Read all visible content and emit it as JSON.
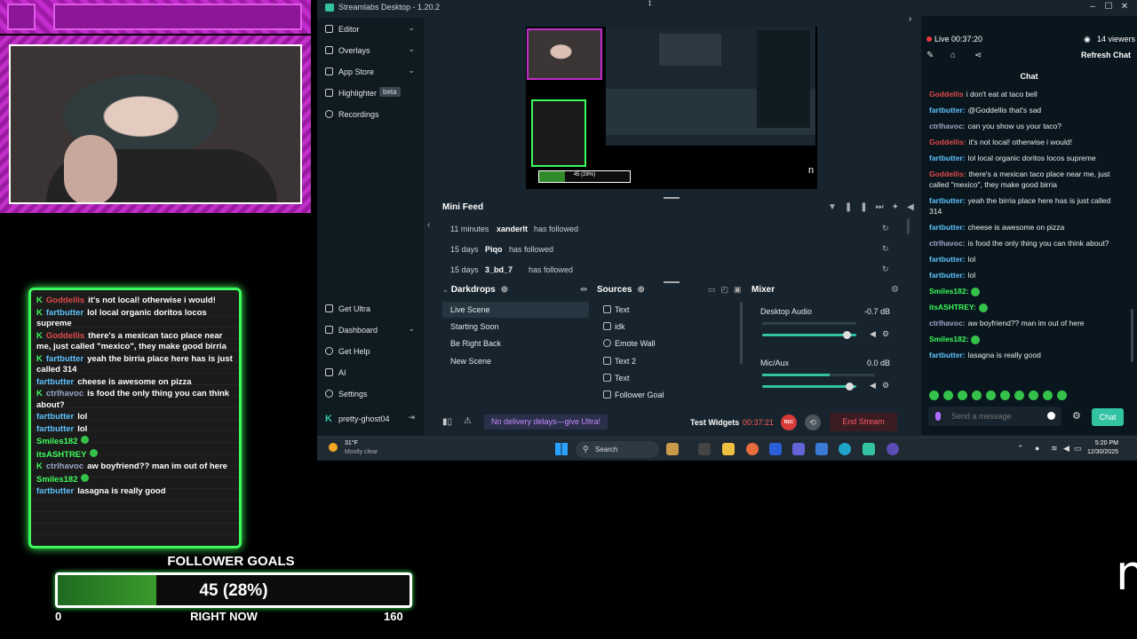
{
  "overlay": {
    "chat": [
      {
        "name": "Goddellis",
        "color": "red",
        "text": "it's not local! otherwise i would!",
        "k": true
      },
      {
        "name": "fartbutter",
        "color": "blue",
        "text": "lol local organic doritos locos supreme",
        "k": true
      },
      {
        "name": "Goddellis",
        "color": "red",
        "text": "there's a mexican taco place near me, just called \"mexico\", they make good birria",
        "k": true
      },
      {
        "name": "fartbutter",
        "color": "blue",
        "text": "yeah the birria place here has is just called 314",
        "k": true
      },
      {
        "name": "fartbutter",
        "color": "blue",
        "text": "cheese is awesome on pizza",
        "k": false
      },
      {
        "name": "ctrlhavoc",
        "color": "grey",
        "text": "is food the only thing you can think about?",
        "k": true
      },
      {
        "name": "fartbutter",
        "color": "blue",
        "text": "lol",
        "k": false
      },
      {
        "name": "fartbutter",
        "color": "blue",
        "text": "lol",
        "k": false
      },
      {
        "name": "Smiles182",
        "color": "green",
        "text": "",
        "k": false
      },
      {
        "name": "itsASHTREY",
        "color": "green",
        "text": "",
        "k": false
      },
      {
        "name": "ctrlhavoc",
        "color": "grey",
        "text": "aw boyfriend?? man im out of here",
        "k": true
      },
      {
        "name": "Smiles182",
        "color": "green",
        "text": "",
        "k": false
      },
      {
        "name": "fartbutter",
        "color": "blue",
        "text": "lasagna is really good",
        "k": false
      }
    ],
    "follower_goal": {
      "title": "FOLLOWER GOALS",
      "value_label": "45 (28%)",
      "progress_fraction": 0.28,
      "min": "0",
      "max": "160",
      "subtitle": "RIGHT NOW"
    },
    "corner_glyph": "n"
  },
  "app": {
    "title": "Streamlabs Desktop - 1.20.2",
    "nav": [
      {
        "label": "Editor",
        "chevron": true
      },
      {
        "label": "Overlays",
        "chevron": true
      },
      {
        "label": "App Store",
        "chevron": true
      },
      {
        "label": "Highlighter",
        "badge": "beta"
      },
      {
        "label": "Recordings"
      }
    ],
    "nav_bottom": [
      {
        "label": "Get Ultra"
      },
      {
        "label": "Dashboard",
        "chevron": true
      },
      {
        "label": "Get Help"
      },
      {
        "label": "AI"
      },
      {
        "label": "Settings"
      }
    ],
    "username": "pretty-ghost04",
    "preview_glyph": "n",
    "preview_goal_label": "45 (28%)",
    "mini_feed": {
      "title": "Mini Feed",
      "rows": [
        {
          "time": "11 minutes",
          "user": "xanderlt",
          "action": "has followed"
        },
        {
          "time": "15 days",
          "user": "Piqo",
          "action": "has followed"
        },
        {
          "time": "15 days",
          "user": "3_bd_7",
          "action": "has followed"
        }
      ]
    },
    "scenes": {
      "title": "Darkdrops",
      "items": [
        "Live Scene",
        "Starting Soon",
        "Be Right Back",
        "New Scene"
      ],
      "active_index": 0
    },
    "sources": {
      "title": "Sources",
      "items": [
        "Text",
        "idk",
        "Emote Wall",
        "Text 2",
        "Text",
        "Follower Goal"
      ]
    },
    "mixer": {
      "title": "Mixer",
      "channels": [
        {
          "name": "Desktop Audio",
          "db": "-0.7 dB",
          "level": 0.0,
          "volume": 0.9
        },
        {
          "name": "Mic/Aux",
          "db": "0.0 dB",
          "level": 0.6,
          "volume": 0.92
        }
      ]
    },
    "footer": {
      "promo": "No delivery delays—give Ultra!",
      "test_widgets": "Test Widgets",
      "timer": "00:37:21",
      "rec": "REC",
      "end_stream": "End Stream"
    },
    "chat_panel": {
      "live_label": "Live 00:37:20",
      "viewers": "14 viewers",
      "refresh": "Refresh Chat",
      "header": "Chat",
      "messages": [
        {
          "name": "Goddellis",
          "color": "#e34a4a",
          "text": "i don't eat at taco bell"
        },
        {
          "name": "fartbutter:",
          "color": "#5ec3ff",
          "text": "@Goddellis that's sad"
        },
        {
          "name": "ctrlhavoc:",
          "color": "#9ca7c9",
          "text": "can you show us your taco?"
        },
        {
          "name": "Goddellis:",
          "color": "#e34a4a",
          "text": "it's not local! otherwise i would!"
        },
        {
          "name": "fartbutter:",
          "color": "#5ec3ff",
          "text": "lol local organic doritos locos supreme"
        },
        {
          "name": "Goddellis:",
          "color": "#e34a4a",
          "text": "there's a mexican taco place near me, just called \"mexico\", they make good birria"
        },
        {
          "name": "fartbutter:",
          "color": "#5ec3ff",
          "text": "yeah the birria place here has is just called 314"
        },
        {
          "name": "fartbutter:",
          "color": "#5ec3ff",
          "text": "cheese is awesome on pizza"
        },
        {
          "name": "ctrlhavoc:",
          "color": "#9ca7c9",
          "text": "is food the only thing you can think about?"
        },
        {
          "name": "fartbutter:",
          "color": "#5ec3ff",
          "text": "lol"
        },
        {
          "name": "fartbutter:",
          "color": "#5ec3ff",
          "text": "lol"
        },
        {
          "name": "Smiles182:",
          "color": "#3cfc5c",
          "text": ""
        },
        {
          "name": "itsASHTREY:",
          "color": "#3cfc5c",
          "text": ""
        },
        {
          "name": "ctrlhavoc:",
          "color": "#9ca7c9",
          "text": "aw boyfriend?? man im out of here"
        },
        {
          "name": "Smiles182:",
          "color": "#3cfc5c",
          "text": ""
        },
        {
          "name": "fartbutter:",
          "color": "#5ec3ff",
          "text": "lasagna is really good"
        }
      ],
      "input_placeholder": "Send a message",
      "send_label": "Chat"
    }
  },
  "taskbar": {
    "temp": "31°F",
    "condition": "Mostly clear",
    "search": "Search",
    "time": "5:20 PM",
    "date": "12/30/2025"
  },
  "colors": {
    "accent": "#31c3a2",
    "overlay_green": "#3cfc5c",
    "overlay_magenta": "#c22ccc",
    "live_red": "#e83a3a"
  }
}
